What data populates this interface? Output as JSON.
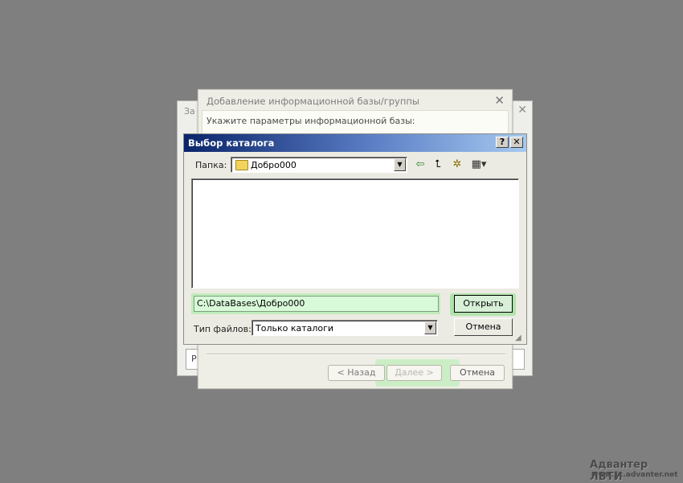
{
  "back_dialog": {
    "title": "За",
    "close_glyph": "✕",
    "inner_text": "Р"
  },
  "wizard_dialog": {
    "title": "Добавление информационной базы/группы",
    "close_glyph": "✕",
    "hint": "Укажите параметры информационной базы:",
    "back_label": "< Назад",
    "next_label": "Далее >",
    "cancel_label": "Отмена"
  },
  "folder_dialog": {
    "title": "Выбор каталога",
    "help_glyph": "?",
    "close_glyph": "✕",
    "folder_label": "Папка:",
    "folder_value": "Добро000",
    "path_value": "C:\\DataBases\\Добро000",
    "open_label": "Открыть",
    "filetype_label": "Тип файлов:",
    "filetype_value": "Только каталоги",
    "cancel_label": "Отмена",
    "toolbar": {
      "back_icon": "⇦",
      "up_icon": "⮤",
      "new_folder_icon": "✲",
      "view_icon": "▦▾"
    }
  },
  "watermark": {
    "brand": "Адвантер ЛВТИ",
    "url": "www.1c.advanter.net"
  }
}
